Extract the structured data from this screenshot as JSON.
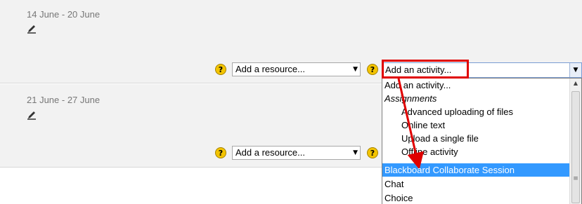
{
  "weeks": [
    {
      "title": "14 June - 20 June"
    },
    {
      "title": "21 June - 27 June"
    }
  ],
  "controls": {
    "help_glyph": "?",
    "resource_select_value": "Add a resource...",
    "activity_select_value": "Add an activity..."
  },
  "activity_dropdown": {
    "options": [
      {
        "label": "Add an activity...",
        "kind": "option"
      },
      {
        "label": "Assignments",
        "kind": "group"
      },
      {
        "label": "Advanced uploading of files",
        "kind": "sub"
      },
      {
        "label": "Online text",
        "kind": "sub"
      },
      {
        "label": "Upload a single file",
        "kind": "sub"
      },
      {
        "label": "Offline activity",
        "kind": "sub"
      },
      {
        "label": "Blackboard Collaborate Session",
        "kind": "option",
        "selected": true
      },
      {
        "label": "Chat",
        "kind": "option"
      },
      {
        "label": "Choice",
        "kind": "option"
      }
    ]
  },
  "icons": {
    "edit": "edit-summary-icon",
    "help": "help-icon",
    "dropdown": "chevron-down-icon"
  },
  "colors": {
    "annotation": "#e00000",
    "selection": "#3399ff",
    "help": "#f3c400"
  }
}
